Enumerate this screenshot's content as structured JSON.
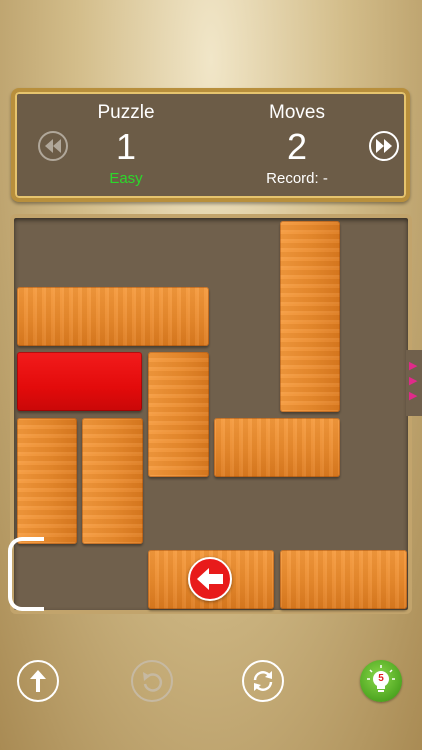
{
  "header": {
    "puzzle_label": "Puzzle",
    "puzzle_number": "1",
    "difficulty": "Easy",
    "moves_label": "Moves",
    "moves_count": "2",
    "record_text": "Record: -"
  },
  "hint_badge": "5",
  "colors": {
    "difficulty_green": "#2bd92b",
    "target_block_red": "#e30b0b",
    "wood_orange": "#ea8a2c",
    "exit_arrow_pink": "#e02a8a"
  },
  "icons": {
    "prev": "rewind-icon",
    "next": "fast-forward-icon",
    "exit": "arrow-up-icon",
    "undo": "undo-icon",
    "restart": "restart-icon",
    "hint": "lightbulb-icon"
  }
}
